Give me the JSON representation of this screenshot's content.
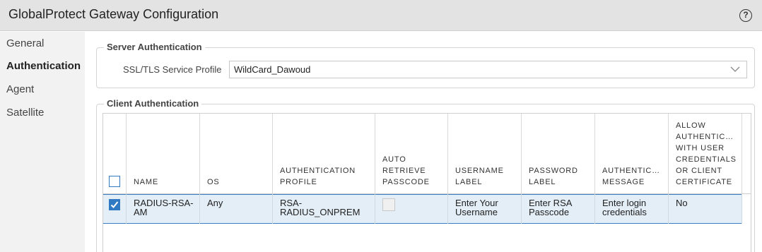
{
  "window": {
    "title": "GlobalProtect Gateway Configuration",
    "help_icon": "?"
  },
  "sidebar": {
    "items": [
      {
        "label": "General"
      },
      {
        "label": "Authentication"
      },
      {
        "label": "Agent"
      },
      {
        "label": "Satellite"
      }
    ]
  },
  "server_auth": {
    "legend": "Server Authentication",
    "profile_label": "SSL/TLS Service Profile",
    "profile_value": "WildCard_Dawoud"
  },
  "client_auth": {
    "legend": "Client Authentication",
    "headers": {
      "name": "NAME",
      "os": "OS",
      "auth_profile": "AUTHENTICATION\nPROFILE",
      "auto_retrieve": "AUTO\nRETRIEVE\nPASSCODE",
      "username_label": "USERNAME\nLABEL",
      "password_label": "PASSWORD\nLABEL",
      "auth_message": "AUTHENTIC…\nMESSAGE",
      "allow_auth": "ALLOW\nAUTHENTIC…\nWITH USER\nCREDENTIALS\nOR CLIENT\nCERTIFICATE"
    },
    "rows": [
      {
        "checked": true,
        "name": "RADIUS-RSA-\nAM",
        "os": "Any",
        "auth_profile": "RSA-\nRADIUS_ONPREM",
        "auto_retrieve": false,
        "username_label": "Enter Your\nUsername",
        "password_label": "Enter RSA\nPasscode",
        "auth_message": "Enter login\ncredentials",
        "allow_auth": "No"
      }
    ]
  }
}
